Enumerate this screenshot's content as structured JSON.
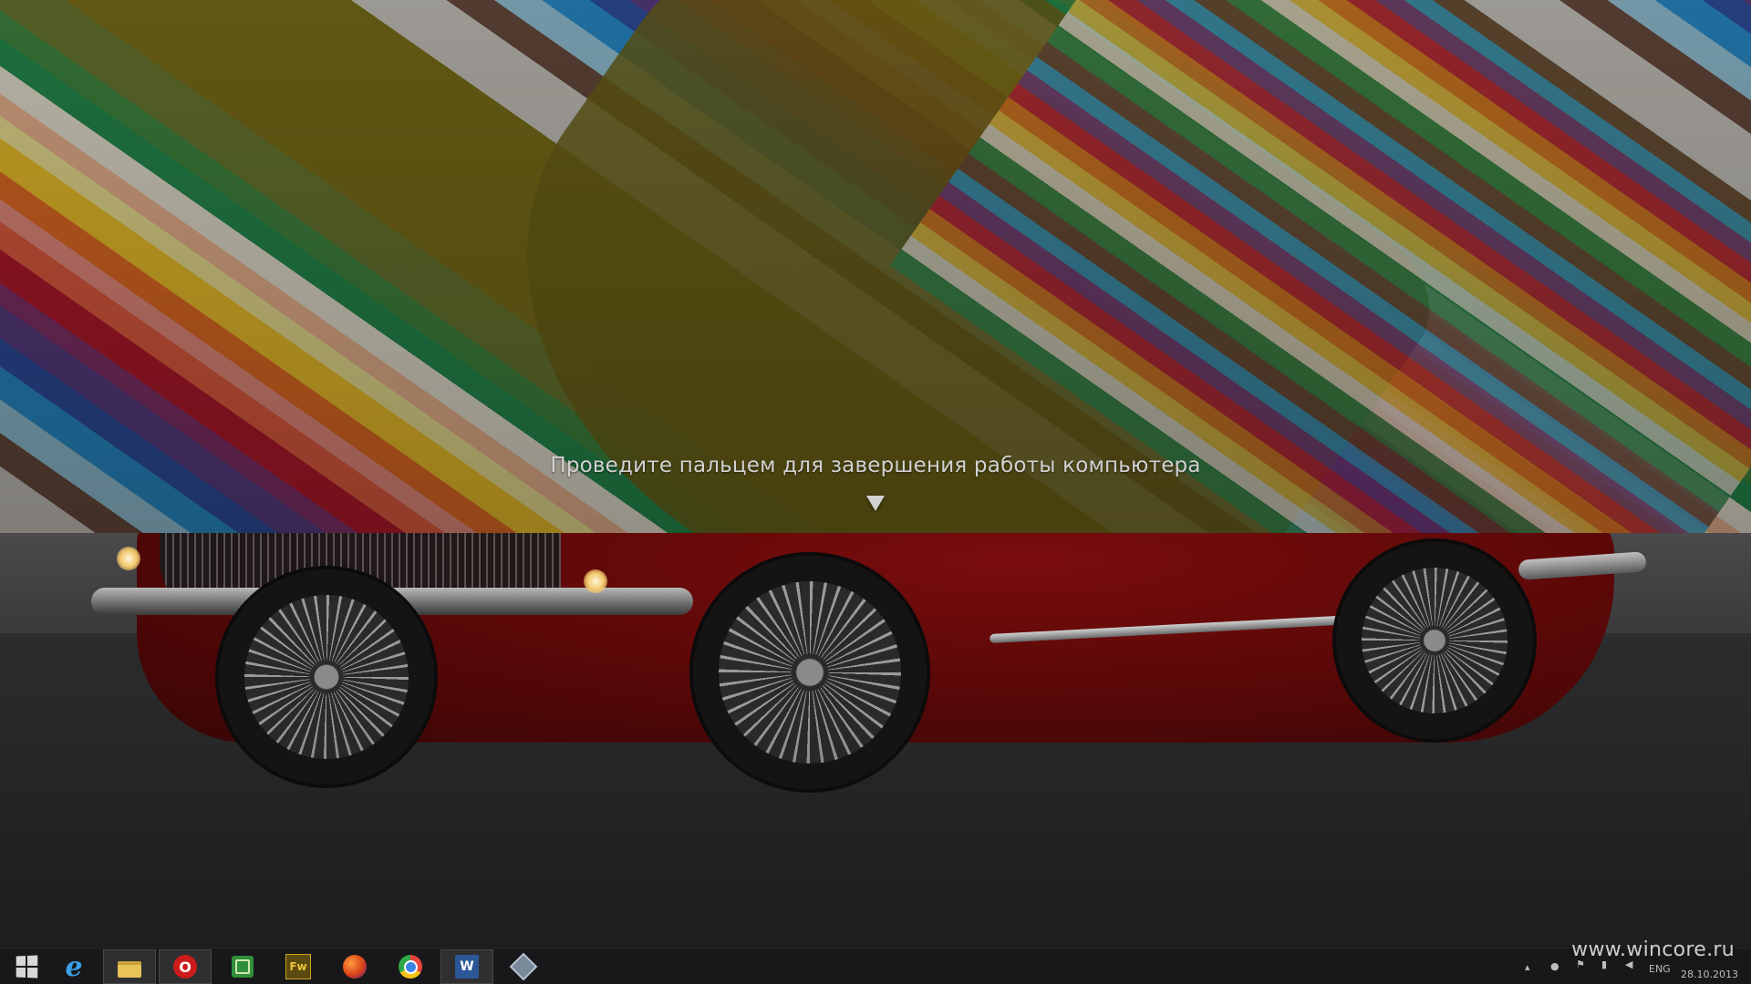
{
  "shutdown_screen": {
    "swipe_text": "Проведите пальцем для завершения работы компьютера",
    "arrow_icon": "down-triangle-icon"
  },
  "taskbar": {
    "items": [
      {
        "name": "start",
        "icon": "windows-logo-icon",
        "label": "",
        "active": false
      },
      {
        "name": "internet-explorer",
        "icon": "internet-explorer-icon",
        "label": "e",
        "active": false
      },
      {
        "name": "file-explorer",
        "icon": "folder-icon",
        "label": "",
        "active": true
      },
      {
        "name": "opera",
        "icon": "opera-icon",
        "label": "O",
        "active": true
      },
      {
        "name": "app-green",
        "icon": "green-app-icon",
        "label": "",
        "active": false
      },
      {
        "name": "fireworks",
        "icon": "fireworks-icon",
        "label": "Fw",
        "active": false
      },
      {
        "name": "firefox",
        "icon": "firefox-icon",
        "label": "",
        "active": false
      },
      {
        "name": "chrome",
        "icon": "chrome-icon",
        "label": "",
        "active": false
      },
      {
        "name": "word",
        "icon": "word-icon",
        "label": "W",
        "active": true
      },
      {
        "name": "virtualbox",
        "icon": "virtualbox-icon",
        "label": "",
        "active": false
      }
    ],
    "tray": {
      "language": "ENG",
      "date": "28.10.2013"
    }
  },
  "watermark": "www.wincore.ru",
  "colors": {
    "taskbar_bg": "#18181a",
    "car_red": "#7a0c0c",
    "olive": "#7d7010",
    "opera_red": "#cc1b1b",
    "word_blue": "#2b5797",
    "fireworks_yellow": "#c8a21a"
  }
}
